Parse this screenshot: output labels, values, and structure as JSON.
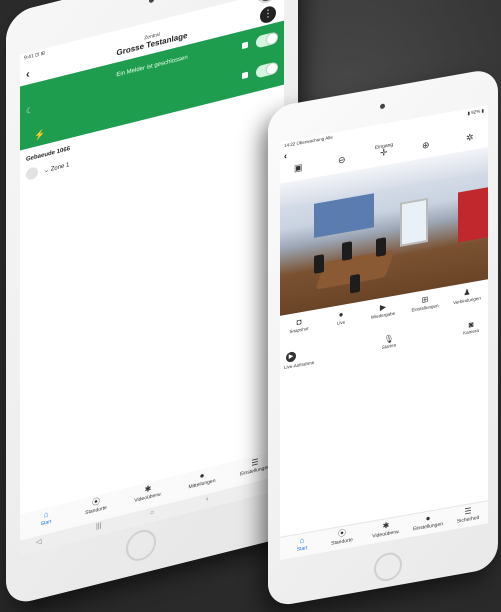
{
  "back_tablet": {
    "status_left": "9:41 ⊡ ⊞",
    "status_right": "◉ ⊿ ✉ ▮",
    "header_subtitle": "Zentral",
    "header_title": "Grosse Testanlage",
    "green_message": "Ein Melder ist geschlossen",
    "section_label": "Gebaeude 1066",
    "zone_label": "Zone 1",
    "nav": [
      {
        "label": "Start",
        "icon": "home-icon"
      },
      {
        "label": "Standorte",
        "icon": "location-icon"
      },
      {
        "label": "Videoüberw.",
        "icon": "camera-icon"
      },
      {
        "label": "Mitteilungen",
        "icon": "message-icon"
      },
      {
        "label": "Einstellungen",
        "icon": "menu-icon"
      }
    ],
    "android_nav": [
      "◁",
      "|||",
      "○",
      "‹"
    ]
  },
  "front_tablet": {
    "status_left": "14:22 Überwachung Alle",
    "status_right": "▮ 92% ▮",
    "title": "Eingang",
    "controls": [
      {
        "label": "Snapshot"
      },
      {
        "label": "Live"
      },
      {
        "label": "Wiedergabe"
      },
      {
        "label": "Einstellungen"
      },
      {
        "label": "Verbindungen"
      }
    ],
    "row2_left": "Live-Aufnahme",
    "row2_mid": "Starten",
    "row2_right": "Kamera",
    "nav": [
      {
        "label": "Start"
      },
      {
        "label": "Standorte"
      },
      {
        "label": "Videoüberw."
      },
      {
        "label": "Einstellungen"
      },
      {
        "label": "Sicherheit"
      }
    ]
  },
  "colors": {
    "accent_green": "#1f9d4f",
    "active_blue": "#1a73e8"
  }
}
